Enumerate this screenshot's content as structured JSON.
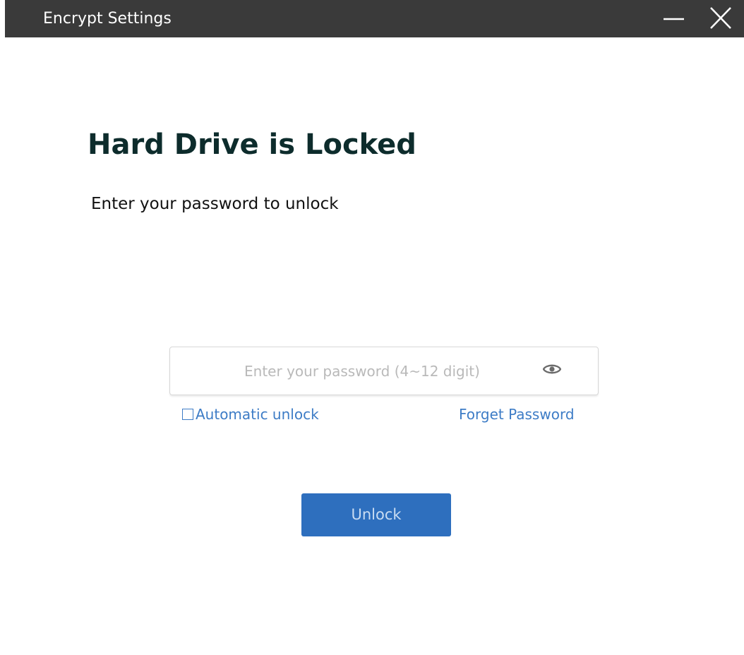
{
  "window": {
    "title": "Encrypt Settings"
  },
  "main": {
    "heading": "Hard Drive is Locked",
    "subheading": "Enter your password to unlock",
    "password": {
      "placeholder": "Enter your password (4~12 digit)",
      "value": ""
    },
    "auto_unlock_label": "Automatic unlock",
    "auto_unlock_checked": false,
    "forget_password_label": "Forget Password",
    "unlock_button_label": "Unlock"
  },
  "icons": {
    "minimize": "minimize-icon",
    "close": "close-icon",
    "show_password": "eye-icon"
  },
  "colors": {
    "titlebar": "#3a3a3a",
    "heading": "#0d2c2c",
    "link": "#3d7cc6",
    "button": "#2e6fbe"
  }
}
